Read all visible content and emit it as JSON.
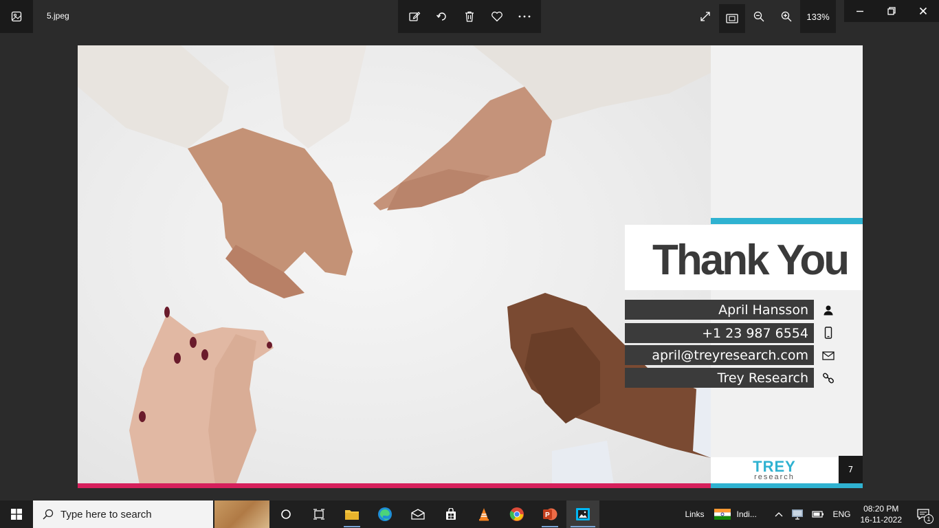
{
  "window": {
    "filename": "5.jpeg",
    "zoom": "133%"
  },
  "slide": {
    "title": "Thank You",
    "contacts": [
      {
        "text": "April Hansson",
        "icon": "person-icon"
      },
      {
        "text": "+1 23 987 6554",
        "icon": "phone-icon"
      },
      {
        "text": "april@treyresearch.com",
        "icon": "mail-icon"
      },
      {
        "text": "Trey Research",
        "icon": "link-icon"
      }
    ],
    "logo_main": "TREY",
    "logo_sub": "research",
    "page_number": "7",
    "colors": {
      "teal": "#2fb2d1",
      "pink": "#d6205c",
      "dark": "#3b3b3b"
    }
  },
  "taskbar": {
    "search_placeholder": "Type here to search",
    "links_label": "Links",
    "news_label": "Indi...",
    "language": "ENG",
    "time": "08:20 PM",
    "date": "16-11-2022",
    "notification_count": "1"
  }
}
